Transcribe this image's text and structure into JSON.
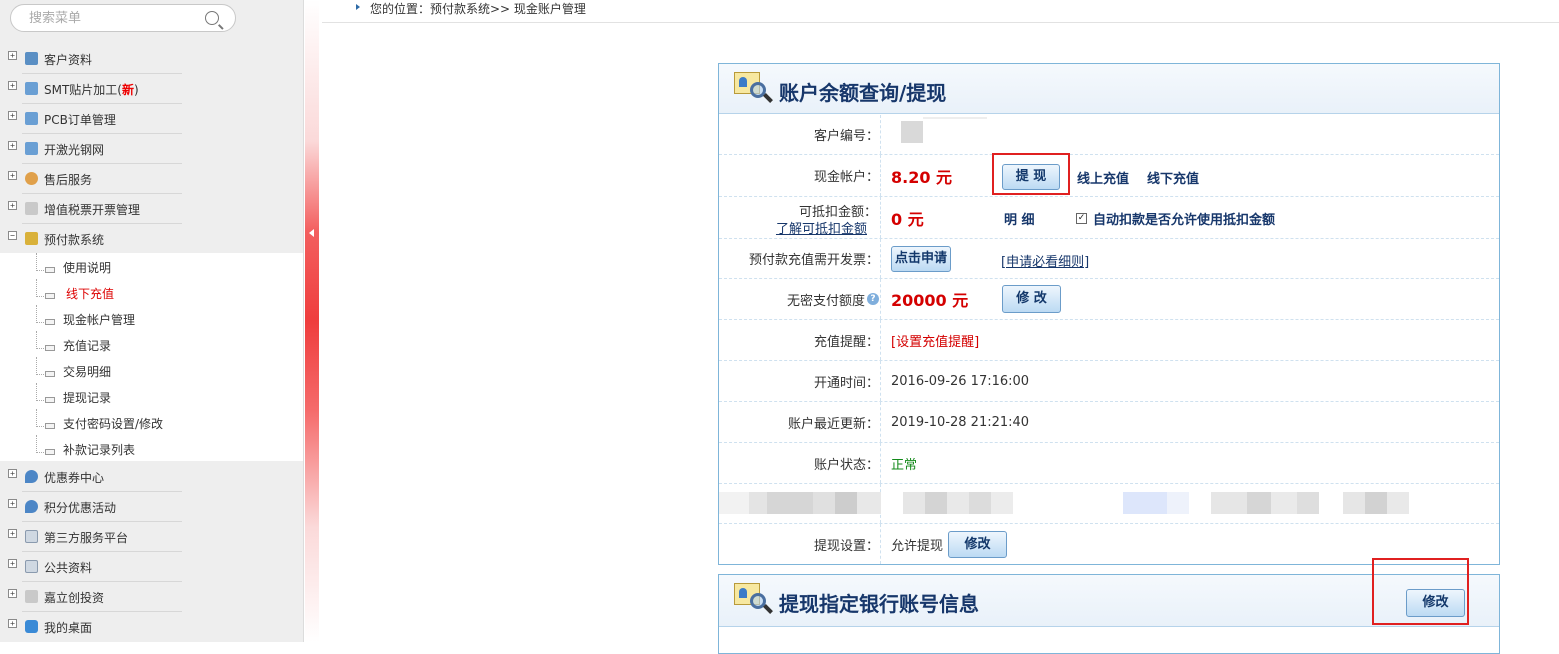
{
  "search": {
    "placeholder": "搜索菜单"
  },
  "sidebar": {
    "items": [
      {
        "label": "客户资料",
        "icon": "user-icon"
      },
      {
        "label": "SMT贴片加工(",
        "badge": "新",
        "suffix": ")",
        "icon": "chip-icon"
      },
      {
        "label": "PCB订单管理",
        "icon": "board-icon"
      },
      {
        "label": "开激光钢网",
        "icon": "stencil-icon"
      },
      {
        "label": "售后服务",
        "icon": "support-icon"
      },
      {
        "label": "增值税票开票管理",
        "icon": "invoice-icon"
      },
      {
        "label": "预付款系统",
        "icon": "wallet-icon"
      },
      {
        "label": "优惠券中心",
        "icon": "coupon-icon"
      },
      {
        "label": "积分优惠活动",
        "icon": "points-icon"
      },
      {
        "label": "第三方服务平台",
        "icon": "platform-icon"
      },
      {
        "label": "公共资料",
        "icon": "folder-icon"
      },
      {
        "label": "嘉立创投资",
        "icon": "invest-icon"
      },
      {
        "label": "我的桌面",
        "icon": "desktop-icon"
      }
    ],
    "subitems": [
      {
        "label": "使用说明"
      },
      {
        "label": "线下充值"
      },
      {
        "label": "现金帐户管理"
      },
      {
        "label": "充值记录"
      },
      {
        "label": "交易明细"
      },
      {
        "label": "提现记录"
      },
      {
        "label": "支付密码设置/修改"
      },
      {
        "label": "补款记录列表"
      }
    ]
  },
  "breadcrumb": {
    "text": "您的位置：预付款系统>> 现金账户管理"
  },
  "panel1": {
    "title": "账户余额查询/提现",
    "rows": {
      "customer_no": {
        "label": "客户编号："
      },
      "cash": {
        "label": "现金帐户：",
        "amount": "8.20 元",
        "withdraw_btn": "提 现",
        "online": "线上充值",
        "offline": "线下充值"
      },
      "deduct": {
        "label": "可抵扣金额：",
        "learn": "了解可抵扣金额",
        "amount": "0 元",
        "detail": "明 细",
        "auto": "自动扣款是否允许使用抵扣金额"
      },
      "invoice": {
        "label": "预付款充值需开发票：",
        "apply_btn": "点击申请",
        "rules": "[申请必看细则]"
      },
      "nopwd": {
        "label": "无密支付额度",
        "amount": "20000 元",
        "edit_btn": "修 改"
      },
      "remind": {
        "label": "充值提醒：",
        "link": "[设置充值提醒]"
      },
      "opened": {
        "label": "开通时间：",
        "value": "2016-09-26 17:16:00"
      },
      "updated": {
        "label": "账户最近更新：",
        "value": "2019-10-28 21:21:40"
      },
      "status": {
        "label": "账户状态：",
        "value": "正常"
      },
      "withdraw_setting": {
        "label": "提现设置：",
        "value": "允许提现",
        "edit_btn": "修改"
      }
    }
  },
  "panel2": {
    "title": "提现指定银行账号信息",
    "edit_btn": "修改"
  },
  "colors": {
    "accent": "#17376b",
    "money": "#d40000",
    "status_ok": "#138a1a",
    "highlight": "#e02020"
  }
}
